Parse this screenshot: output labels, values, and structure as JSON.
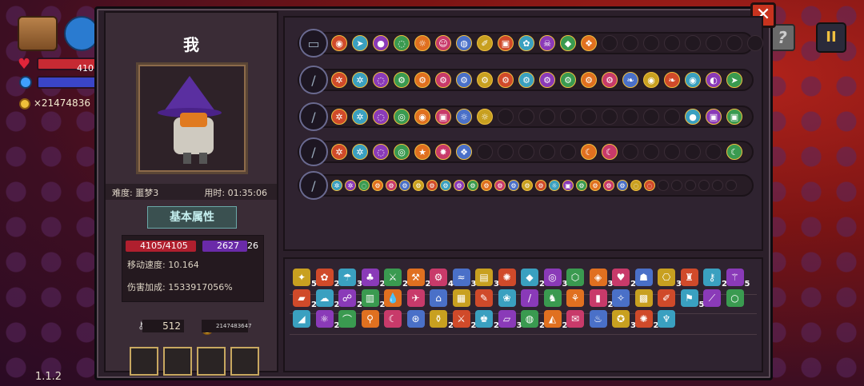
{
  "hud": {
    "hp_text": "410",
    "gold_text": "×21474836",
    "version": "1.1.2",
    "help_label": "?",
    "pause_label": "II"
  },
  "panel": {
    "close_label": "✕",
    "player_name": "我",
    "difficulty": "难度: 噩梦3",
    "time": "用时: 01:35:06",
    "attr_tab": "基本属性",
    "hp": "4105/4105",
    "mp": "2627",
    "mp_extra": "26",
    "move_speed": "移动速度: 10.164",
    "damage_bonus": "伤害加成: 1533917056%",
    "keys": "512",
    "gold": "2147483647"
  },
  "colors": {
    "chip_palette": [
      "#c8a020",
      "#d04a2a",
      "#3aa0c0",
      "#8a3ab8",
      "#3a9a50",
      "#e07020",
      "#c83a6a",
      "#4a70c8"
    ]
  },
  "loadouts": [
    {
      "weapon": "chest-icon",
      "chips": [
        "eye",
        "arrow",
        "bomb",
        "swirl",
        "sun",
        "ghost",
        "orb",
        "quill",
        "jar",
        "flower",
        "skull",
        "diamond",
        "rune"
      ],
      "empty": 8
    },
    {
      "weapon": "staff-icon",
      "chips": [
        "gear",
        "gear",
        "swirl",
        "cog",
        "cog",
        "cog",
        "cog",
        "cog",
        "cog",
        "cog",
        "cog",
        "cog",
        "cog",
        "cog",
        "sprout",
        "eye",
        "sprout",
        "eye",
        "drop",
        "arrow"
      ],
      "empty": 0
    },
    {
      "weapon": "leaf-staff-icon",
      "chips": [
        "gear",
        "gear",
        "swirl",
        "vortex",
        "eye",
        "jar",
        "sun",
        "sun"
      ],
      "empty": 9,
      "tail": [
        "bomb",
        "jar",
        "jar"
      ]
    },
    {
      "weapon": "spear-icon",
      "chips": [
        "gear",
        "gear",
        "swirl",
        "target",
        "star",
        "burst",
        "rune"
      ],
      "empty": 5,
      "mid": [
        "crescent",
        "crescent"
      ],
      "empty2": 5,
      "tail": [
        "crescent"
      ]
    },
    {
      "weapon": "crystal-wand-icon",
      "chips": [
        "gear",
        "gear",
        "swirl",
        "cog",
        "cog",
        "cog",
        "cog",
        "cog",
        "cog",
        "cog",
        "cog",
        "cog",
        "cog",
        "cog",
        "cog",
        "cog",
        "sun",
        "jar",
        "cog",
        "cog",
        "cog",
        "cog",
        "swirl",
        "swirl"
      ],
      "empty": 6
    }
  ],
  "inventory": {
    "row1": [
      [
        "✦",
        "5"
      ],
      [
        "✿",
        "2"
      ],
      [
        "☂",
        "3"
      ],
      [
        "♣",
        "2"
      ],
      [
        "⚔",
        "2"
      ],
      [
        "⚒",
        "2"
      ],
      [
        "⚙",
        "4"
      ],
      [
        "≈",
        "3"
      ],
      [
        "▤",
        "3"
      ],
      [
        "✺",
        ""
      ],
      [
        "◆",
        "2"
      ],
      [
        "◎",
        "3"
      ],
      [
        "⬡",
        ""
      ],
      [
        "◈",
        "3"
      ],
      [
        "♥",
        "2"
      ],
      [
        "☗",
        ""
      ],
      [
        "⎔",
        "3"
      ],
      [
        "♜",
        ""
      ],
      [
        "⚷",
        "2"
      ],
      [
        "⚚",
        "5"
      ]
    ],
    "row2": [
      [
        "▰",
        "2"
      ],
      [
        "☁",
        "2"
      ],
      [
        "☍",
        "2"
      ],
      [
        "▥",
        "2"
      ],
      [
        "💧",
        ""
      ],
      [
        "✈",
        ""
      ],
      [
        "⌂",
        ""
      ],
      [
        "▦",
        ""
      ],
      [
        "✎",
        ""
      ],
      [
        "❀",
        ""
      ],
      [
        "/",
        ""
      ],
      [
        "♞",
        ""
      ],
      [
        "⚘",
        ""
      ],
      [
        "▮",
        "2"
      ],
      [
        "✧",
        ""
      ],
      [
        "▩",
        ""
      ],
      [
        "✐",
        ""
      ],
      [
        "⚑",
        "5"
      ],
      [
        "⟋",
        ""
      ],
      [
        "○",
        ""
      ]
    ],
    "row3": [
      [
        "◢",
        ""
      ],
      [
        "⚛",
        "2"
      ],
      [
        "⌒",
        ""
      ],
      [
        "⚲",
        ""
      ],
      [
        "☾",
        ""
      ],
      [
        "⊛",
        ""
      ],
      [
        "⚱",
        "2"
      ],
      [
        "⚔",
        "2"
      ],
      [
        "♚",
        "2"
      ],
      [
        "▱",
        "3"
      ],
      [
        "◍",
        "2"
      ],
      [
        "◭",
        "2"
      ],
      [
        "✉",
        ""
      ],
      [
        "♨",
        ""
      ],
      [
        "✪",
        "3"
      ],
      [
        "✺",
        "2"
      ],
      [
        "♆",
        ""
      ]
    ]
  }
}
